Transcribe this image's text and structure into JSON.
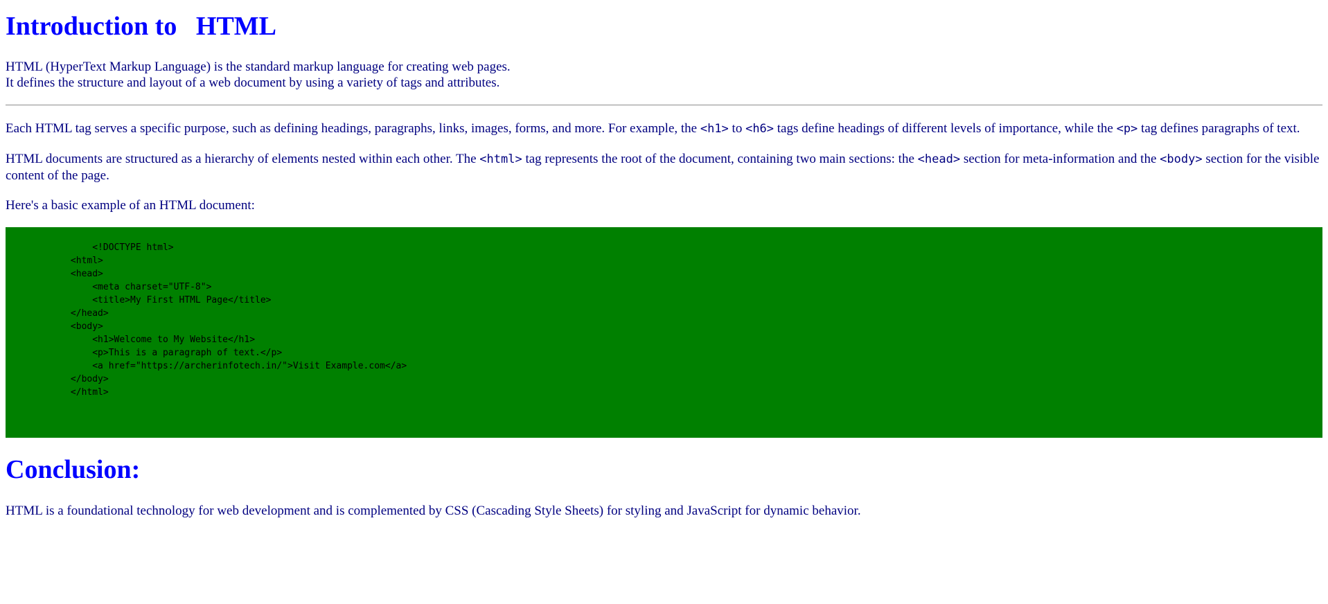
{
  "header": {
    "title_part1": "Introduction to",
    "title_part2": "HTML"
  },
  "intro": {
    "line1": "HTML (HyperText Markup Language) is the standard markup language for creating web pages.",
    "line2": "It defines the structure and layout of a web document by using a variety of tags and attributes."
  },
  "paragraph1": {
    "t1": "Each HTML tag serves a specific purpose, such as defining headings, paragraphs, links, images, forms, and more. For example, the ",
    "c1": "<h1>",
    "t2": " to ",
    "c2": "<h6>",
    "t3": " tags define headings of different levels of importance, while the ",
    "c3": "<p>",
    "t4": " tag defines paragraphs of text."
  },
  "paragraph2": {
    "t1": "HTML documents are structured as a hierarchy of elements nested within each other. The ",
    "c1": "<html>",
    "t2": " tag represents the root of the document, containing two main sections: the ",
    "c2": "<head>",
    "t3": " section for meta-information and the ",
    "c3": "<body>",
    "t4": " section for the visible content of the page."
  },
  "example_intro": "Here's a basic example of an HTML document:",
  "code_example": {
    "lines": [
      "                <!DOCTYPE html>",
      "            <html>",
      "            <head>",
      "                <meta charset=\"UTF-8\">",
      "                <title>My First HTML Page</title>",
      "            </head>",
      "            <body>",
      "                <h1>Welcome to My Website</h1>",
      "                <p>This is a paragraph of text.</p>",
      "                <a href=\"https://archerinfotech.in/\">Visit Example.com</a>",
      "            </body>",
      "            </html>"
    ]
  },
  "conclusion": {
    "heading": "Conclusion:",
    "text": "HTML is a foundational technology for web development and is complemented by CSS (Cascading Style Sheets) for styling and JavaScript for dynamic behavior."
  },
  "colors": {
    "heading": "#0000ff",
    "body_text": "#000080",
    "code_background": "#008000",
    "code_text": "#000000"
  }
}
